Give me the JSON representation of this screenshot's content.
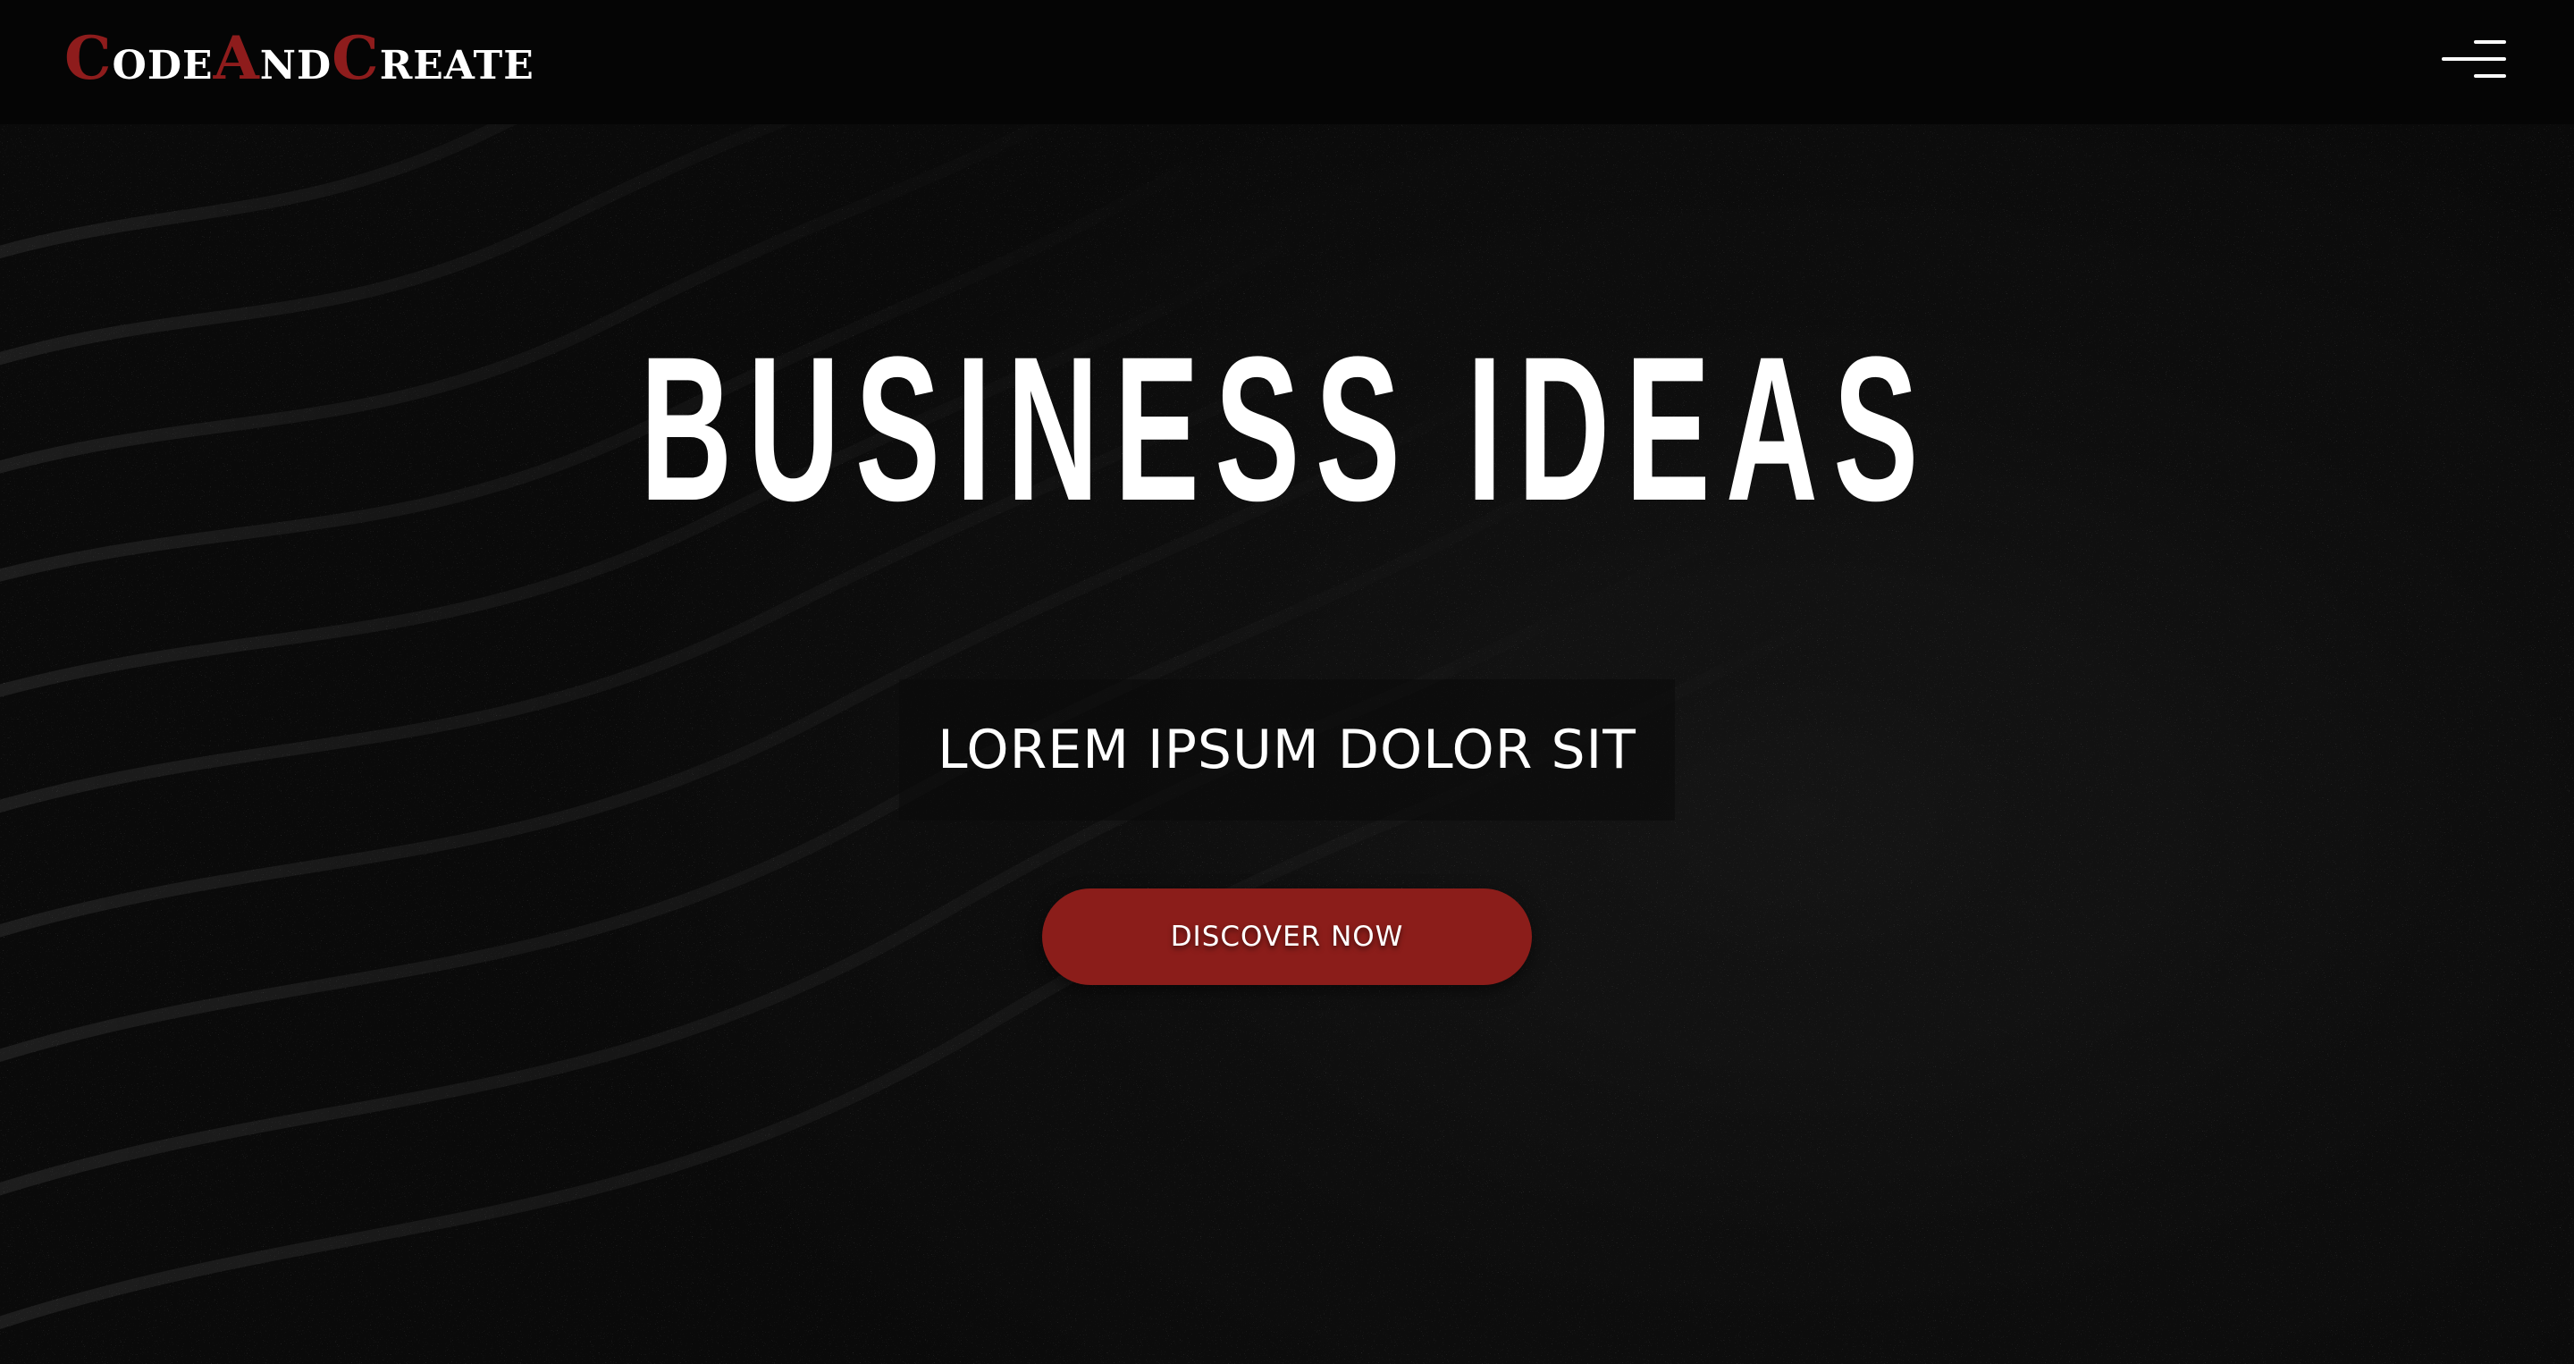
{
  "header": {
    "logo": {
      "parts": [
        {
          "cap": "C",
          "rest": "ode"
        },
        {
          "cap": "A",
          "rest": "nd"
        },
        {
          "cap": "C",
          "rest": "reate"
        }
      ]
    },
    "menu_icon": "hamburger-menu-icon"
  },
  "hero": {
    "headline": "BUSINESS IDEAS",
    "subtitle": "LOREM IPSUM DOLOR SIT",
    "cta_label": "DISCOVER NOW"
  },
  "colors": {
    "accent": "#8b1d1a",
    "header_bg": "#050505",
    "hero_bg": "#121212",
    "text": "#ffffff"
  }
}
